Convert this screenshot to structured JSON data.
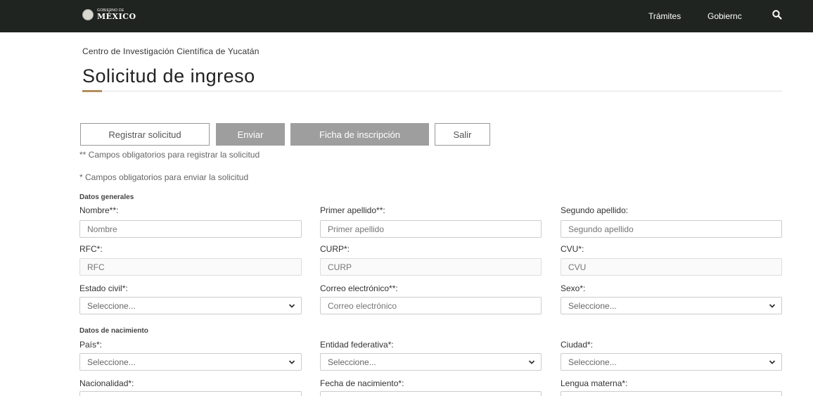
{
  "header": {
    "logo_small": "GOBIERNO DE",
    "logo_big": "MÉXICO",
    "nav": [
      "Trámites",
      "Gobiernc"
    ]
  },
  "page": {
    "institution": "Centro de Investigación Científica de Yucatán",
    "title": "Solicitud de ingreso"
  },
  "buttons": {
    "register": "Registrar solicitud",
    "send": "Enviar",
    "ficha": "Ficha de inscripción",
    "exit": "Salir"
  },
  "notes": {
    "register_required": "** Campos obligatorios para registrar la solicitud",
    "send_required": "* Campos obligatorios para enviar la solicitud"
  },
  "sections": {
    "general": "Datos generales",
    "birth": "Datos de nacimiento"
  },
  "fields": {
    "nombre": {
      "label": "Nombre**:",
      "placeholder": "Nombre"
    },
    "primer_apellido": {
      "label": "Primer apellido**:",
      "placeholder": "Primer apellido"
    },
    "segundo_apellido": {
      "label": "Segundo apellido:",
      "placeholder": "Segundo apellido"
    },
    "rfc": {
      "label": "RFC*:",
      "placeholder": "RFC"
    },
    "curp": {
      "label": "CURP*:",
      "placeholder": "CURP"
    },
    "cvu": {
      "label": "CVU*:",
      "placeholder": "CVU"
    },
    "estado_civil": {
      "label": "Estado civil*:",
      "value": "Seleccione..."
    },
    "correo": {
      "label": "Correo electrónico**:",
      "placeholder": "Correo electrónico"
    },
    "sexo": {
      "label": "Sexo*:",
      "value": "Seleccione..."
    },
    "pais": {
      "label": "País*:",
      "value": "Seleccione..."
    },
    "entidad": {
      "label": "Entidad federativa*:",
      "value": "Seleccione..."
    },
    "ciudad": {
      "label": "Ciudad*:",
      "value": "Seleccione..."
    },
    "nacionalidad": {
      "label": "Nacionalidad*:"
    },
    "fecha_nacimiento": {
      "label": "Fecha de nacimiento*:"
    },
    "lengua_materna": {
      "label": "Lengua materna*:"
    }
  },
  "colors": {
    "header_bg": "#1f2421",
    "accent": "#b38e5d",
    "button_disabled": "#9e9e9e"
  }
}
